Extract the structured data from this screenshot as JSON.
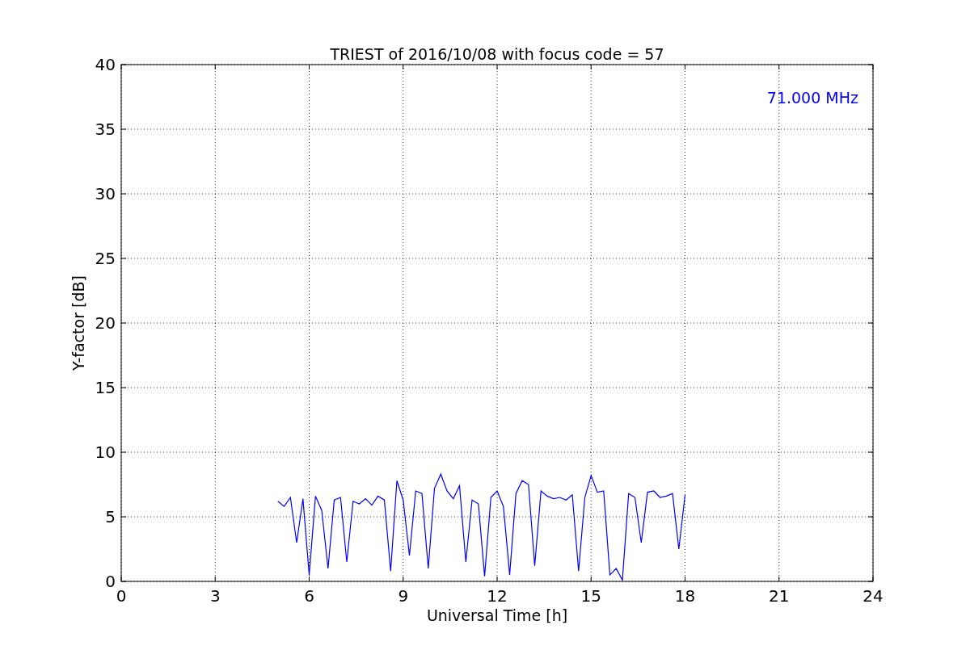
{
  "chart_data": {
    "type": "line",
    "title": "TRIEST of 2016/10/08 with focus code = 57",
    "xlabel": "Universal Time [h]",
    "ylabel": "Y-factor [dB]",
    "x": [
      5.0,
      5.2,
      5.4,
      5.6,
      5.8,
      6.0,
      6.2,
      6.4,
      6.6,
      6.8,
      7.0,
      7.2,
      7.4,
      7.6,
      7.8,
      8.0,
      8.2,
      8.4,
      8.6,
      8.8,
      9.0,
      9.2,
      9.4,
      9.6,
      9.8,
      10.0,
      10.2,
      10.4,
      10.6,
      10.8,
      11.0,
      11.2,
      11.4,
      11.6,
      11.8,
      12.0,
      12.2,
      12.4,
      12.6,
      12.8,
      13.0,
      13.2,
      13.4,
      13.6,
      13.8,
      14.0,
      14.2,
      14.4,
      14.6,
      14.8,
      15.0,
      15.2,
      15.4,
      15.6,
      15.8,
      16.0,
      16.2,
      16.4,
      16.6,
      16.8,
      17.0,
      17.2,
      17.4,
      17.6,
      17.8,
      18.0
    ],
    "series": [
      {
        "name": "71.000 MHz",
        "color": "#0000ff",
        "values": [
          6.2,
          5.8,
          6.5,
          3.0,
          6.4,
          0.5,
          6.6,
          5.5,
          1.0,
          6.3,
          6.5,
          1.5,
          6.2,
          6.0,
          6.4,
          5.9,
          6.6,
          6.3,
          0.8,
          7.8,
          6.3,
          2.0,
          7.0,
          6.8,
          1.0,
          7.2,
          8.3,
          7.0,
          6.4,
          7.4,
          1.5,
          6.3,
          6.0,
          0.4,
          6.5,
          7.0,
          5.8,
          0.5,
          6.8,
          7.8,
          7.5,
          1.2,
          7.0,
          6.6,
          6.4,
          6.5,
          6.3,
          6.7,
          0.8,
          6.5,
          8.2,
          6.9,
          7.0,
          0.5,
          1.0,
          0.1,
          6.8,
          6.5,
          3.0,
          6.9,
          7.0,
          6.5,
          6.6,
          6.8,
          2.5,
          6.7
        ]
      }
    ],
    "xlim": [
      0,
      24
    ],
    "ylim": [
      0,
      40
    ],
    "xticks": [
      0,
      3,
      6,
      9,
      12,
      15,
      18,
      21,
      24
    ],
    "yticks": [
      0,
      5,
      10,
      15,
      20,
      25,
      30,
      35,
      40
    ],
    "grid": true
  }
}
